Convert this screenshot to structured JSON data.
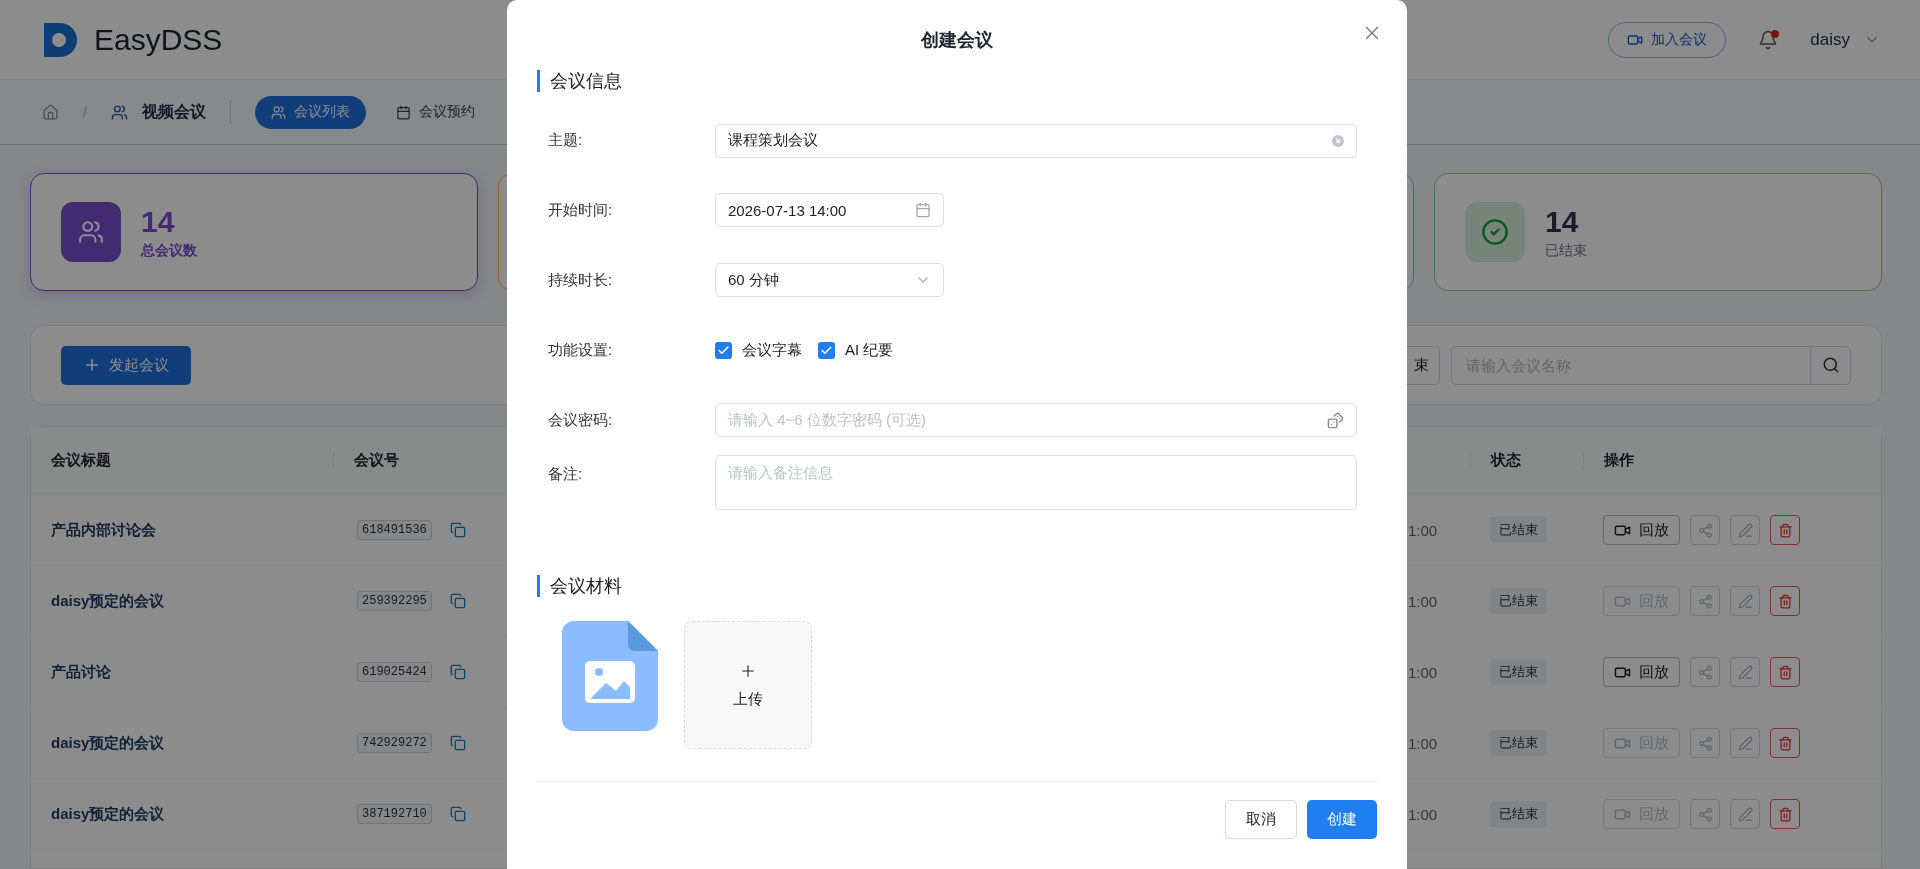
{
  "header": {
    "app_name": "EasyDSS",
    "join_button": "加入会议",
    "notification_unread": true,
    "user": "daisy"
  },
  "breadcrumb": {
    "separator": "/",
    "section": "视频会议",
    "tabs": [
      {
        "label": "会议列表",
        "selected": true
      },
      {
        "label": "会议预约",
        "selected": false
      }
    ]
  },
  "stats": [
    {
      "kind": "total",
      "value": "14",
      "label": "总会议数",
      "selected": true
    },
    {
      "kind": "warning",
      "selected": false
    },
    {
      "kind": "info",
      "selected": false
    },
    {
      "kind": "ended",
      "value": "14",
      "label": "已结束",
      "selected": false
    }
  ],
  "toolbar": {
    "new_button": "发起会议",
    "filter_button": "束",
    "search": {
      "placeholder": "请输入会议名称"
    }
  },
  "table": {
    "columns": [
      {
        "label": "会议标题"
      },
      {
        "label": "会议号"
      },
      {
        "label": "状态"
      },
      {
        "label": "操作"
      }
    ],
    "rows": [
      {
        "title": "产品内部讨论会",
        "code": "618491536",
        "time": "1:00",
        "status": "已结束",
        "replay": "回放",
        "replay_disabled": false
      },
      {
        "title": "daisy预定的会议",
        "code": "259392295",
        "time": "1:00",
        "status": "已结束",
        "replay": "回放",
        "replay_disabled": true
      },
      {
        "title": "产品讨论",
        "code": "619025424",
        "time": "1:00",
        "status": "已结束",
        "replay": "回放",
        "replay_disabled": false
      },
      {
        "title": "daisy预定的会议",
        "code": "742929272",
        "time": "1:00",
        "status": "已结束",
        "replay": "回放",
        "replay_disabled": true
      },
      {
        "title": "daisy预定的会议",
        "code": "387192710",
        "time": "1:00",
        "status": "已结束",
        "replay": "回放",
        "replay_disabled": true
      }
    ]
  },
  "dialog": {
    "title": "创建会议",
    "info_heading": "会议信息",
    "fields": [
      {
        "kind": "text",
        "label": "主题:",
        "value": "课程策划会议"
      },
      {
        "kind": "date",
        "label": "开始时间:",
        "value": "2026-07-13 14:00"
      },
      {
        "kind": "select",
        "label": "持续时长:",
        "value": "60 分钟"
      },
      {
        "kind": "checkboxes",
        "label": "功能设置:",
        "options": [
          {
            "label": "会议字幕",
            "checked": true
          },
          {
            "label": "AI 纪要",
            "checked": true
          }
        ]
      },
      {
        "kind": "password",
        "label": "会议密码:",
        "placeholder": "请输入 4~6 位数字密码 (可选)"
      },
      {
        "kind": "textarea",
        "label": "备注:",
        "placeholder": "请输入备注信息"
      }
    ],
    "materials_heading": "会议材料",
    "upload_label": "上传",
    "buttons": [
      {
        "label": "取消",
        "kind": "secondary"
      },
      {
        "label": "创建",
        "kind": "primary"
      }
    ]
  }
}
